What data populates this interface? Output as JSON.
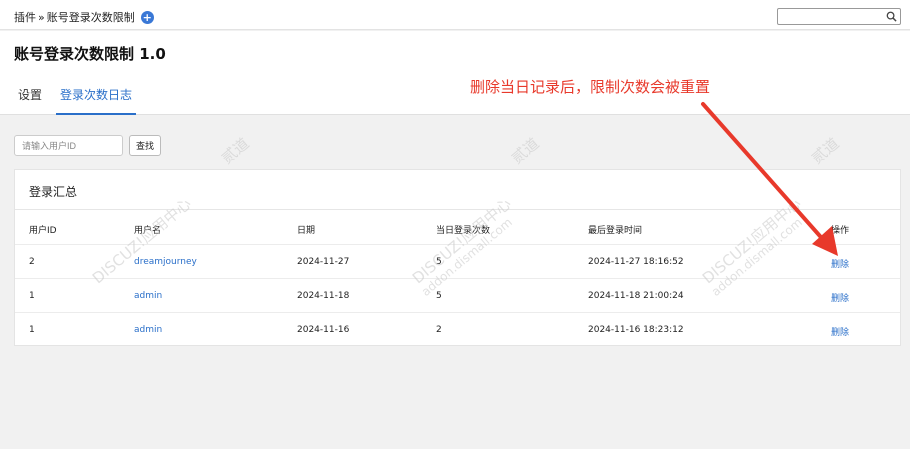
{
  "breadcrumb": {
    "root": "插件",
    "separator": "»",
    "current": "账号登录次数限制"
  },
  "search": {
    "placeholder": ""
  },
  "page": {
    "title": "账号登录次数限制 1.0"
  },
  "tabs": [
    {
      "label": "设置"
    },
    {
      "label": "登录次数日志"
    }
  ],
  "annotation": {
    "text": "删除当日记录后，限制次数会被重置",
    "color": "#e8392b"
  },
  "filter": {
    "placeholder": "请输入用户ID",
    "button": "查找"
  },
  "panel": {
    "title": "登录汇总"
  },
  "table": {
    "headers": [
      "用户ID",
      "用户名",
      "日期",
      "当日登录次数",
      "最后登录时间",
      "操作"
    ],
    "rows": [
      [
        "2",
        "dreamjourney",
        "2024-11-27",
        "5",
        "2024-11-27 18:16:52",
        "删除"
      ],
      [
        "1",
        "admin",
        "2024-11-18",
        "5",
        "2024-11-18 21:00:24",
        "删除"
      ],
      [
        "1",
        "admin",
        "2024-11-16",
        "2",
        "2024-11-16 18:23:12",
        "删除"
      ]
    ]
  },
  "watermark": {
    "brand": "DISCUZ!应用中心",
    "site": "addon.dismall.com",
    "mark": "贰道"
  },
  "colors": {
    "accent": "#2a6fc9",
    "annotation": "#e8392b"
  }
}
